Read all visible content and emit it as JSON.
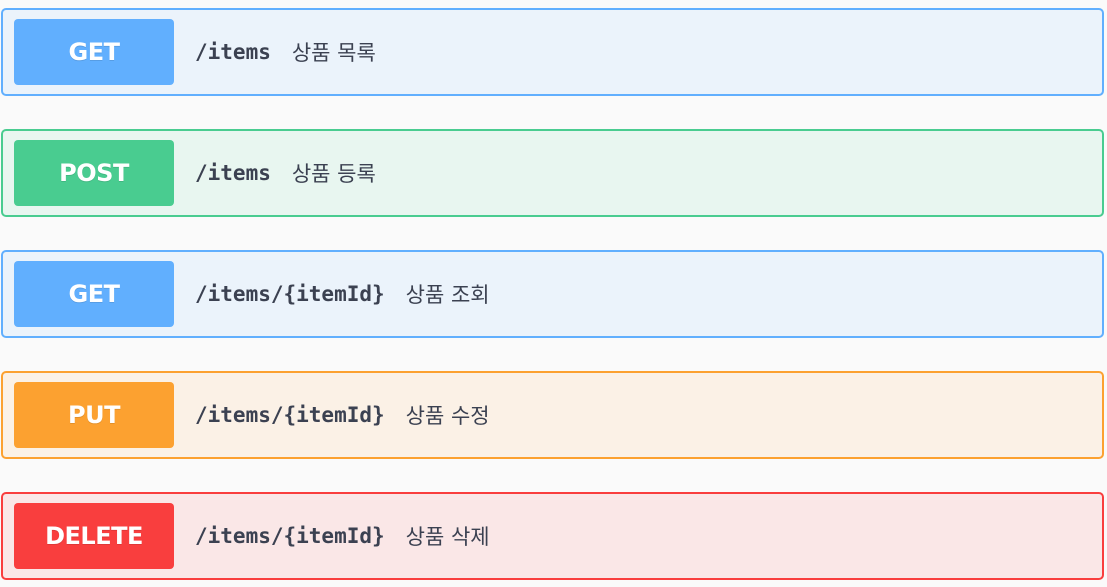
{
  "operations": [
    {
      "method": "GET",
      "path": "/items",
      "description": "상품 목록",
      "color": "#61affe",
      "background": "#ebf3fb"
    },
    {
      "method": "POST",
      "path": "/items",
      "description": "상품 등록",
      "color": "#49cc90",
      "background": "#e8f6f0"
    },
    {
      "method": "GET",
      "path": "/items/{itemId}",
      "description": "상품 조회",
      "color": "#61affe",
      "background": "#ebf3fb"
    },
    {
      "method": "PUT",
      "path": "/items/{itemId}",
      "description": "상품 수정",
      "color": "#fca130",
      "background": "#fbf1e6"
    },
    {
      "method": "DELETE",
      "path": "/items/{itemId}",
      "description": "상품 삭제",
      "color": "#f93e3e",
      "background": "#fae7e7"
    }
  ]
}
